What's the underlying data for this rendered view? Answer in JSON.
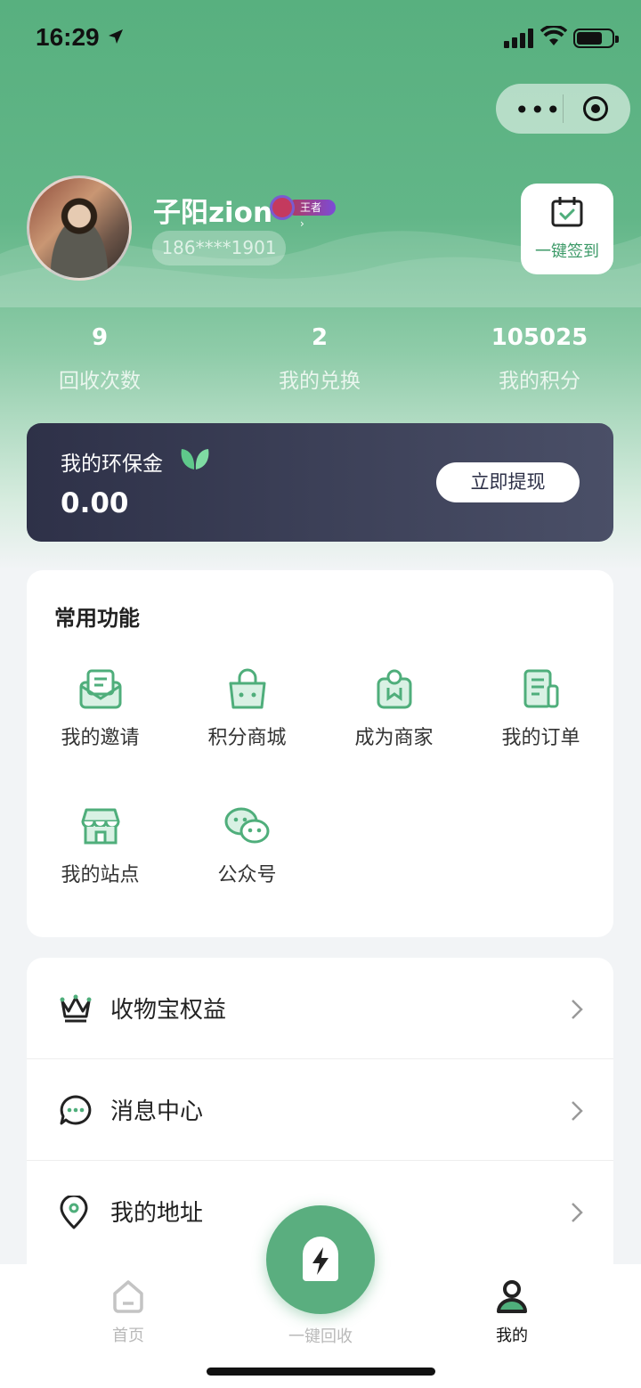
{
  "status": {
    "time": "16:29"
  },
  "profile": {
    "name": "子阳zion",
    "rank": "王者",
    "phone": "186****1901",
    "signin_label": "一键签到"
  },
  "stats": [
    {
      "value": "9",
      "label": "回收次数"
    },
    {
      "value": "2",
      "label": "我的兑换"
    },
    {
      "value": "105025",
      "label": "我的积分"
    }
  ],
  "wallet": {
    "title": "我的环保金",
    "amount": "0.00",
    "button": "立即提现"
  },
  "functions": {
    "title": "常用功能",
    "items": [
      {
        "label": "我的邀请",
        "icon": "envelope-icon"
      },
      {
        "label": "积分商城",
        "icon": "shopping-bag-icon"
      },
      {
        "label": "成为商家",
        "icon": "merchant-icon"
      },
      {
        "label": "我的订单",
        "icon": "order-document-icon"
      },
      {
        "label": "我的站点",
        "icon": "store-icon"
      },
      {
        "label": "公众号",
        "icon": "wechat-icon"
      }
    ]
  },
  "menu": [
    {
      "label": "收物宝权益",
      "icon": "crown-icon"
    },
    {
      "label": "消息中心",
      "icon": "message-icon"
    },
    {
      "label": "我的地址",
      "icon": "location-pin-icon"
    }
  ],
  "tabbar": {
    "home": "首页",
    "recycle": "一键回收",
    "mine": "我的"
  },
  "colors": {
    "brand": "#5aae7f",
    "wallet_bg": "#2e3148"
  }
}
